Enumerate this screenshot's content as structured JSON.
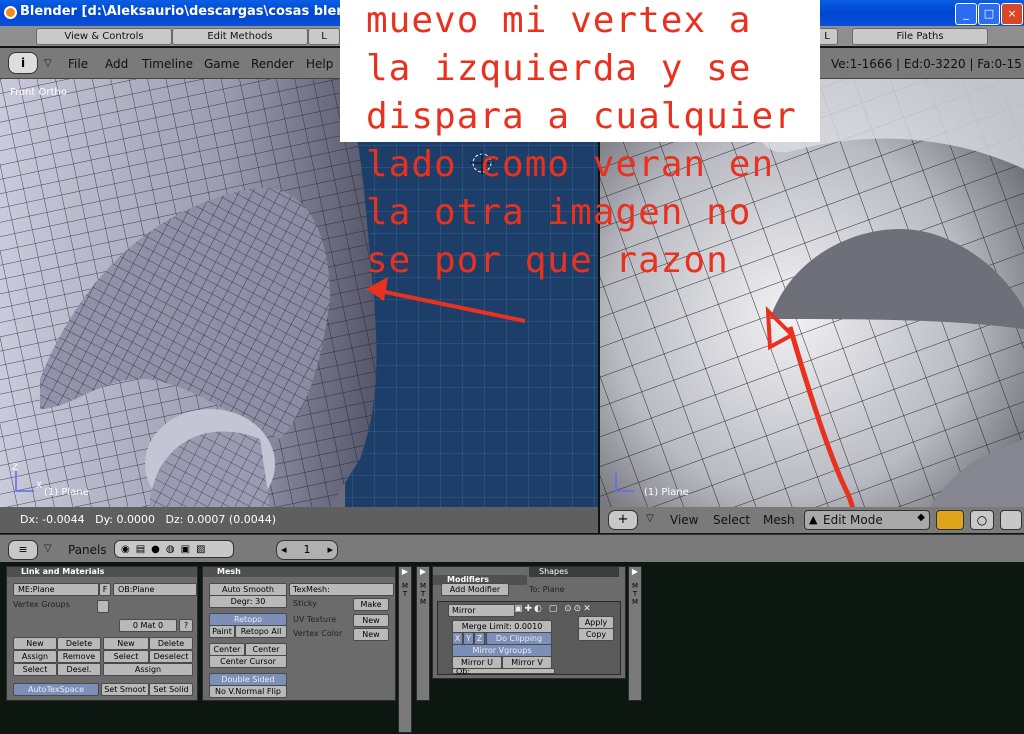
{
  "window": {
    "title": "Blender [d:\\Aleksaurio\\descargas\\cosas blender\\kar",
    "icon": "blender-logo-icon",
    "controls": [
      "_",
      "□",
      "×"
    ]
  },
  "prefs_tabs": [
    "View & Controls",
    "Edit Methods",
    "L",
    "L",
    "File Paths"
  ],
  "header": {
    "menus": [
      "File",
      "Add",
      "Timeline",
      "Game",
      "Render",
      "Help"
    ],
    "stats": "Ve:1-1666 | Ed:0-3220 | Fa:0-15"
  },
  "viewport_left": {
    "view_label": "Front Ortho",
    "object_label": "(1) Plane",
    "axis_x": "X",
    "axis_z": "Z",
    "status": "Dx: -0.0044   Dy: 0.0000   Dz: 0.0007 (0.0044)"
  },
  "viewport_right": {
    "object_label": "(1) Plane",
    "menus": [
      "View",
      "Select",
      "Mesh"
    ],
    "mode": "Edit Mode"
  },
  "buttons_window": {
    "panels_label": "Panels",
    "frame": "1",
    "link_materials": {
      "title": "Link and Materials",
      "me": "ME:Plane",
      "f": "F",
      "ob": "OB:Plane",
      "vertex_groups": "Vertex Groups",
      "mat": "0 Mat 0",
      "q": "?",
      "buttons_left": [
        "New",
        "Delete",
        "Assign",
        "Remove",
        "Select",
        "Desel."
      ],
      "buttons_right": [
        "New",
        "Delete",
        "Select",
        "Deselect",
        "Assign"
      ],
      "autotex": "AutoTexSpace",
      "set_smooth": "Set Smoot",
      "set_solid": "Set Solid"
    },
    "mesh": {
      "title": "Mesh",
      "auto_smooth": "Auto Smooth",
      "degr": "Degr: 30",
      "texmesh": "TexMesh:",
      "sticky": "Sticky",
      "make": "Make",
      "retopo": "Retopo",
      "paint": "Paint",
      "retopo_all": "Retopo All",
      "uv_texture": "UV Texture",
      "new1": "New",
      "vertex_color": "Vertex Color",
      "new2": "New",
      "center_new": "Center New",
      "center": "Center",
      "center_cursor": "Center Cursor",
      "double_sided": "Double Sided",
      "no_vnormal_flip": "No V.Normal Flip"
    },
    "side_tabs": [
      "M",
      "T",
      "M"
    ],
    "modifiers": {
      "tab_modifiers": "Modifiers",
      "tab_shapes": "Shapes",
      "add_modifier": "Add Modifier",
      "to": "To: Plane",
      "mirror": "Mirror",
      "merge_limit": "Merge Limit: 0.0010",
      "axis": [
        "X",
        "Y",
        "Z"
      ],
      "do_clipping": "Do Clipping",
      "mirror_vgroups": "Mirror Vgroups",
      "mirror_u": "Mirror U",
      "mirror_v": "Mirror V",
      "ob": "Ob:",
      "apply": "Apply",
      "copy": "Copy"
    }
  },
  "annotation": {
    "lines": [
      "muevo mi vertex a",
      "la izquierda y se",
      "dispara a cualquier",
      "lado como veran en",
      "la otra imagen no",
      "se por que razon"
    ],
    "color": "#e8321f"
  }
}
